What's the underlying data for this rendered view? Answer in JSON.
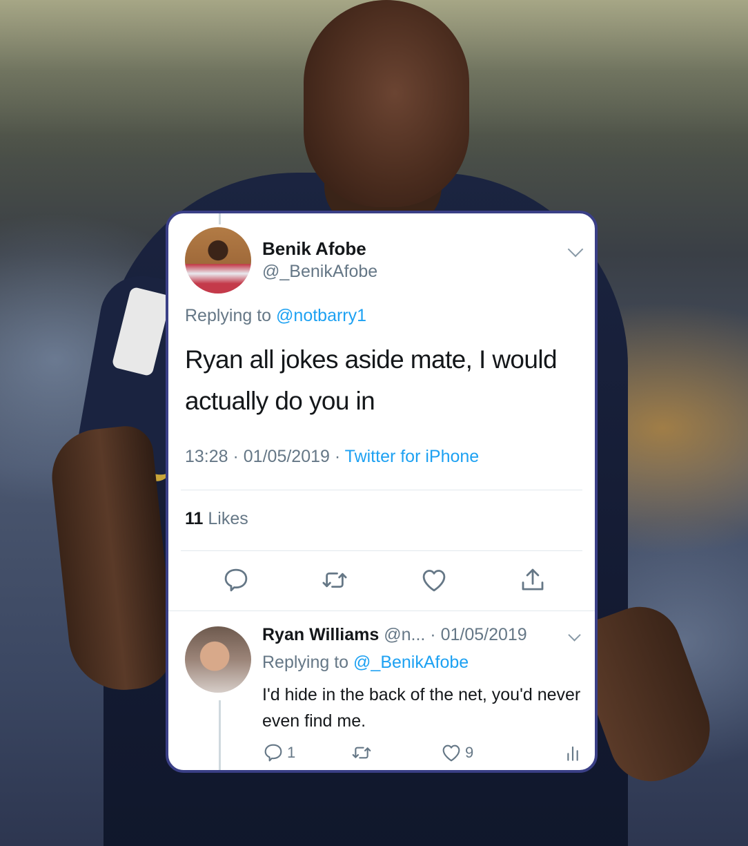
{
  "tweet": {
    "display_name": "Benik Afobe",
    "handle": "@_BenikAfobe",
    "replying_prefix": "Replying to",
    "replying_to": "@notbarry1",
    "text": "Ryan all jokes aside mate, I would actually do you in",
    "time": "13:28",
    "sep1": " · ",
    "date": "01/05/2019",
    "sep2": " · ",
    "source": "Twitter for iPhone",
    "likes_count": "11",
    "likes_label": "Likes"
  },
  "reply": {
    "display_name": "Ryan Williams",
    "handle_and_date": "@n... · 01/05/2019",
    "replying_prefix": "Replying to",
    "replying_to": "@_BenikAfobe",
    "text": "I'd hide in the back of the net, you'd never even find me.",
    "reply_count": "1",
    "like_count": "9"
  },
  "icons": {
    "reply": "reply-icon",
    "retweet": "retweet-icon",
    "like": "heart-icon",
    "share": "share-icon",
    "stats": "analytics-icon",
    "menu": "chevron-down-icon"
  },
  "colors": {
    "link": "#1da1f2",
    "secondary_text": "#657786",
    "card_border": "#3a3f86"
  }
}
